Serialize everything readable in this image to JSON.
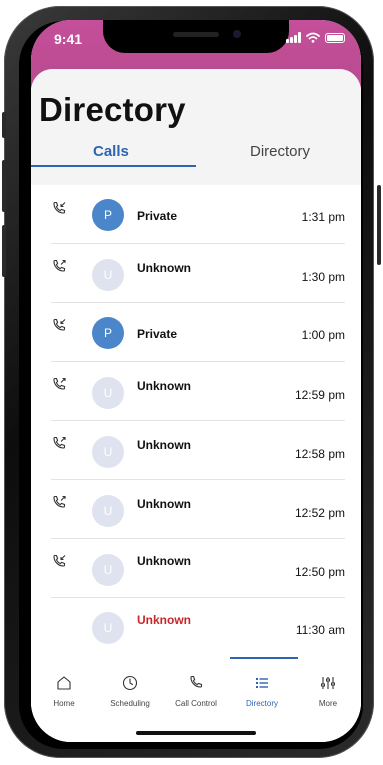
{
  "status_bar": {
    "time": "9:41"
  },
  "header": {
    "title": "Directory"
  },
  "tabs": [
    {
      "label": "Calls",
      "active": true
    },
    {
      "label": "Directory",
      "active": false
    }
  ],
  "calls": [
    {
      "direction": "incoming",
      "initial": "P",
      "name": "Private",
      "time": "1:31 pm",
      "avatar_color": "#4a86c9",
      "name_color": "#111111"
    },
    {
      "direction": "outgoing",
      "initial": "U",
      "name": "Unknown",
      "time": "1:30 pm",
      "avatar_color": "#dfe3ef",
      "name_color": "#111111"
    },
    {
      "direction": "incoming",
      "initial": "P",
      "name": "Private",
      "time": "1:00 pm",
      "avatar_color": "#4a86c9",
      "name_color": "#111111"
    },
    {
      "direction": "outgoing",
      "initial": "U",
      "name": "Unknown",
      "time": "12:59 pm",
      "avatar_color": "#dfe3ef",
      "name_color": "#111111"
    },
    {
      "direction": "outgoing",
      "initial": "U",
      "name": "Unknown",
      "time": "12:58 pm",
      "avatar_color": "#dfe3ef",
      "name_color": "#111111"
    },
    {
      "direction": "outgoing",
      "initial": "U",
      "name": "Unknown",
      "time": "12:52 pm",
      "avatar_color": "#dfe3ef",
      "name_color": "#111111"
    },
    {
      "direction": "incoming",
      "initial": "U",
      "name": "Unknown",
      "time": "12:50 pm",
      "avatar_color": "#dfe3ef",
      "name_color": "#111111"
    },
    {
      "direction": "missed",
      "initial": "U",
      "name": "Unknown",
      "time": "11:30 am",
      "avatar_color": "#dfe3ef",
      "name_color": "#c9252b"
    }
  ],
  "nav": [
    {
      "label": "Home",
      "icon": "home-icon",
      "active": false
    },
    {
      "label": "Scheduling",
      "icon": "clock-icon",
      "active": false
    },
    {
      "label": "Call Control",
      "icon": "phone-icon",
      "active": false
    },
    {
      "label": "Directory",
      "icon": "list-icon",
      "active": true
    },
    {
      "label": "More",
      "icon": "sliders-icon",
      "active": false
    }
  ],
  "colors": {
    "accent": "#2f64b3",
    "status_bar": "#c54f9a",
    "missed": "#c9252b"
  }
}
